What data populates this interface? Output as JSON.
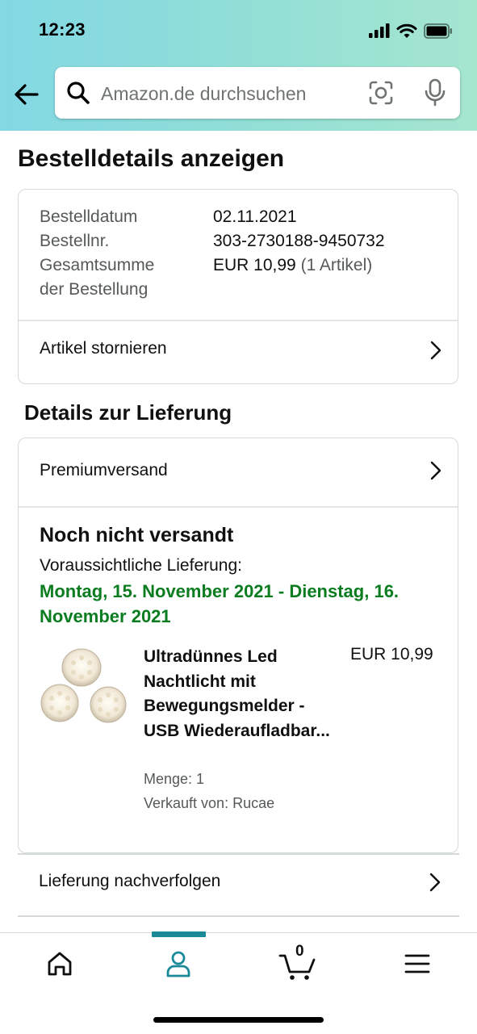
{
  "status_bar": {
    "time": "12:23",
    "icons": [
      "cellular-signal-icon",
      "wifi-icon",
      "battery-icon"
    ]
  },
  "header": {
    "search_placeholder": "Amazon.de durchsuchen",
    "icons": [
      "back-arrow-icon",
      "search-icon",
      "camera-icon",
      "microphone-icon"
    ],
    "gradient": [
      "#82d8e3",
      "#a5e6cf"
    ]
  },
  "page": {
    "title": "Bestelldetails anzeigen"
  },
  "order_summary": {
    "order_date_label": "Bestelldatum",
    "order_date_value": "02.11.2021",
    "order_number_label": "Bestellnr.",
    "order_number_value": "303-2730188-9450732",
    "total_label_line1": "Gesamtsumme",
    "total_label_line2": "der Bestellung",
    "total_value": "EUR 10,99",
    "total_items": "(1 Artikel)",
    "cancel_link": "Artikel stornieren"
  },
  "delivery": {
    "section_title": "Details zur Lieferung",
    "shipping_method": "Premiumversand",
    "status": "Noch nicht versandt",
    "expected_label": "Voraussichtliche Lieferung:",
    "expected_dates": "Montag, 15. November 2021 - Dienstag, 16. November 2021",
    "date_color": "#0b7c1f",
    "product": {
      "title": "Ultradünnes Led Nachtlicht mit Bewegungsmelder - USB Wiederaufladbar...",
      "price": "EUR 10,99",
      "quantity": "Menge: 1",
      "seller": "Verkauft von: Rucae"
    },
    "track_link": "Lieferung nachverfolgen"
  },
  "bottom_nav": {
    "items": [
      "home-icon",
      "account-icon",
      "cart-icon",
      "menu-icon"
    ],
    "active": "account-icon",
    "cart_count": "0",
    "accent": "#1a8a99"
  }
}
